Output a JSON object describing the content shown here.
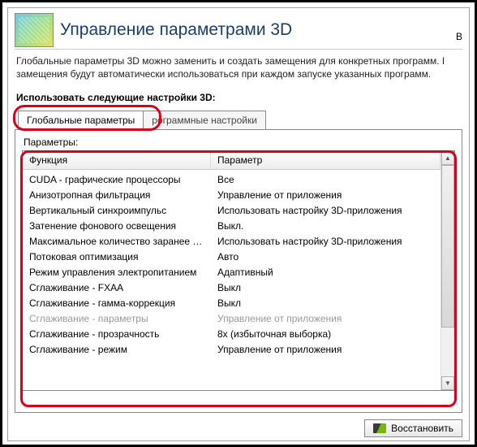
{
  "header": {
    "title": "Управление параметрами 3D",
    "right_cut": "В"
  },
  "description": {
    "line1": "Глобальные параметры 3D можно заменить и создать замещения для конкретных программ. I",
    "line2": "замещения будут автоматически использоваться при каждом запуске указанных программ."
  },
  "section_label": "Использовать следующие настройки 3D:",
  "tabs": {
    "global": "Глобальные параметры",
    "program": "рограммные настройки"
  },
  "table": {
    "label": "Параметры:",
    "col_function": "Функция",
    "col_param": "Параметр",
    "rows": [
      {
        "f": "CUDA - графические процессоры",
        "p": "Все",
        "disabled": false
      },
      {
        "f": "Анизотропная фильтрация",
        "p": "Управление от приложения",
        "disabled": false
      },
      {
        "f": "Вертикальный синхроимпульс",
        "p": "Использовать настройку 3D-приложения",
        "disabled": false
      },
      {
        "f": "Затенение фонового освещения",
        "p": "Выкл.",
        "disabled": false
      },
      {
        "f": "Максимальное количество заранее под...",
        "p": "Использовать настройку 3D-приложения",
        "disabled": false
      },
      {
        "f": "Потоковая оптимизация",
        "p": "Авто",
        "disabled": false
      },
      {
        "f": "Режим управления электропитанием",
        "p": "Адаптивный",
        "disabled": false
      },
      {
        "f": "Сглаживание - FXAA",
        "p": "Выкл",
        "disabled": false
      },
      {
        "f": "Сглаживание - гамма-коррекция",
        "p": "Выкл",
        "disabled": false
      },
      {
        "f": "Сглаживание - параметры",
        "p": "Управление от приложения",
        "disabled": true
      },
      {
        "f": "Сглаживание - прозрачность",
        "p": "8x (избыточная выборка)",
        "disabled": false
      },
      {
        "f": "Сглаживание - режим",
        "p": "Управление от приложения",
        "disabled": false
      }
    ]
  },
  "footer": {
    "restore": "Восстановить"
  }
}
